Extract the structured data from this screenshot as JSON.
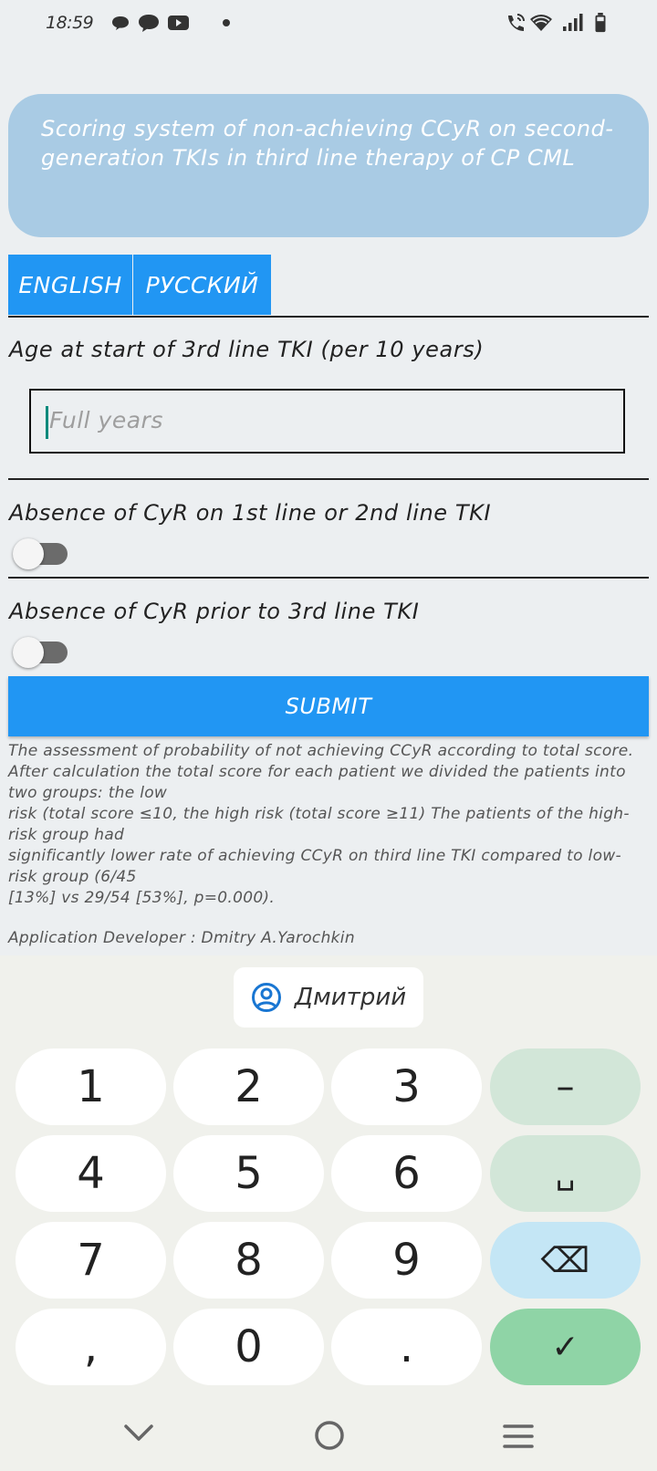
{
  "status_bar": {
    "time": "18:59",
    "left_icons": [
      "chat-bubble-icon",
      "message-icon",
      "youtube-icon",
      "dot-icon"
    ],
    "right_icons": [
      "wifi-call-icon",
      "wifi-icon",
      "signal-icon",
      "battery-icon"
    ]
  },
  "header": {
    "title": "Scoring system of non-achieving CCyR on second-generation TKIs in third line therapy of CP CML"
  },
  "language": {
    "english": "ENGLISH",
    "russian": "РУССКИЙ"
  },
  "form": {
    "age_label": "Age at start of 3rd line TKI (per 10 years)",
    "age_placeholder": "Full years",
    "age_value": "",
    "cyr_first_second_label": "Absence of CyR on 1st line or 2nd line TKI",
    "cyr_first_second_on": false,
    "cyr_prior_third_label": "Absence of CyR prior to 3rd line TKI",
    "cyr_prior_third_on": false,
    "submit_label": "SUBMIT"
  },
  "description": {
    "lines": [
      "  The assessment of probability of not achieving CCyR according to total score. After calculation the total score for each patient we divided the patients into two groups: the low",
      "risk (total score ≤10, the high risk (total score ≥11) The patients of the high-risk group had",
      "significantly lower rate of achieving CCyR on third line TKI compared to low-risk group (6/45",
      "[13%] vs 29/54 [53%], p=0.000)."
    ],
    "developer": "Application Developer : Dmitry A.Yarochkin"
  },
  "keyboard": {
    "suggestion": "Дмитрий",
    "rows": [
      [
        "1",
        "2",
        "3",
        "–"
      ],
      [
        "4",
        "5",
        "6",
        "␣"
      ],
      [
        "7",
        "8",
        "9",
        "⌫"
      ],
      [
        ",",
        "0",
        ".",
        "✓"
      ]
    ]
  }
}
